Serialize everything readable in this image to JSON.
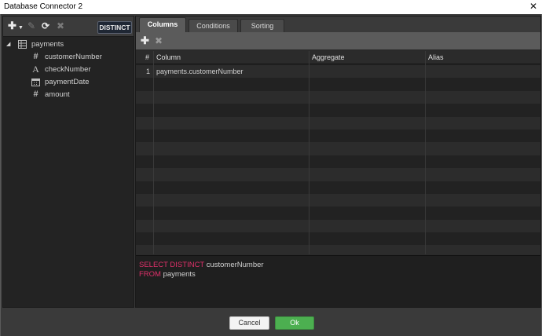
{
  "window": {
    "title": "Database Connector 2",
    "close_glyph": "✕"
  },
  "left_toolbar": {
    "icons": [
      "plus-icon",
      "chevron-down-icon",
      "pencil-icon",
      "refresh-icon",
      "close-icon"
    ],
    "distinct_label": "DISTINCT"
  },
  "tree": {
    "table": {
      "name": "payments",
      "icon": "table-icon"
    },
    "fields": [
      {
        "name": "customerNumber",
        "icon": "hash-icon"
      },
      {
        "name": "checkNumber",
        "icon": "text-icon"
      },
      {
        "name": "paymentDate",
        "icon": "calendar-icon"
      },
      {
        "name": "amount",
        "icon": "hash-icon"
      }
    ]
  },
  "tabs": [
    {
      "label": "Columns",
      "active": true
    },
    {
      "label": "Conditions",
      "active": false
    },
    {
      "label": "Sorting",
      "active": false
    }
  ],
  "grid": {
    "headers": [
      "#",
      "Column",
      "Aggregate",
      "Alias"
    ],
    "rows": [
      {
        "index": "1",
        "column": "payments.customerNumber",
        "aggregate": "",
        "alias": ""
      }
    ]
  },
  "sql": {
    "line1": {
      "keyword": "SELECT DISTINCT",
      "rest": " customerNumber"
    },
    "line2": {
      "keyword": "FROM",
      "rest": " payments"
    }
  },
  "buttons": {
    "cancel": "Cancel",
    "ok": "Ok"
  },
  "colors": {
    "accent_green": "#4caf50",
    "sql_keyword": "#e0306a",
    "background": "#3a3a3a"
  }
}
